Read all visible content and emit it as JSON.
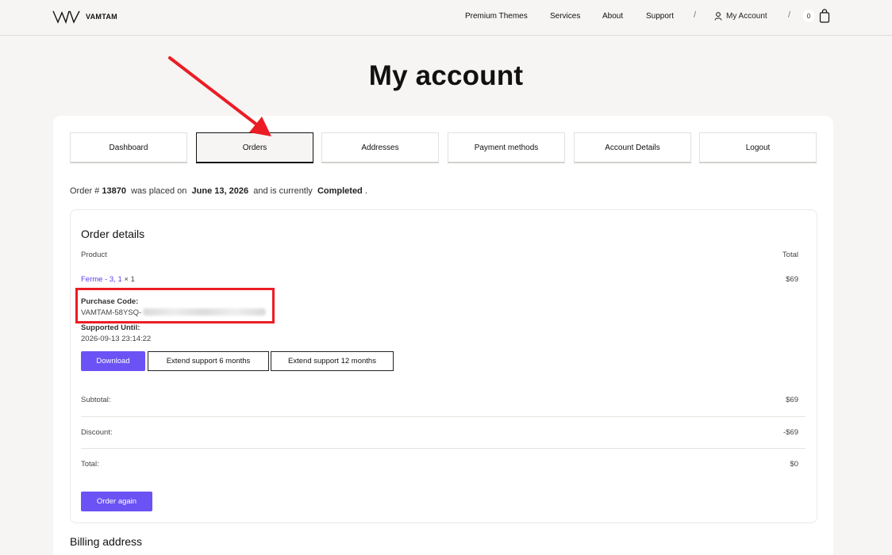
{
  "header": {
    "logo_text": "VAMTAM",
    "nav": [
      "Premium Themes",
      "Services",
      "About",
      "Support"
    ],
    "separator": "/",
    "account_label": "My Account",
    "cart_count": "0"
  },
  "page": {
    "title": "My account"
  },
  "tabs": [
    "Dashboard",
    "Orders",
    "Addresses",
    "Payment methods",
    "Account Details",
    "Logout"
  ],
  "active_tab": "Orders",
  "order_summary": {
    "prefix": "Order #",
    "number": "13870",
    "placed_text": "was placed on",
    "date": "June 13, 2026",
    "status_text": "and is currently",
    "status": "Completed",
    "end": "."
  },
  "order_details": {
    "title": "Order details",
    "col_product": "Product",
    "col_total": "Total",
    "product_link": "Ferme - 3, 1",
    "product_qty": "× 1",
    "product_total": "$69",
    "purchase_code_label": "Purchase Code:",
    "purchase_code_value": "VAMTAM-58YSQ-",
    "supported_until_label": "Supported Until:",
    "supported_until_value": "2026-09-13 23:14:22",
    "btn_download": "Download",
    "btn_extend_6": "Extend support 6 months",
    "btn_extend_12": "Extend support 12 months",
    "subtotal_label": "Subtotal:",
    "subtotal_value": "$69",
    "discount_label": "Discount:",
    "discount_value": "-$69",
    "total_label": "Total:",
    "total_value": "$0",
    "btn_order_again": "Order again"
  },
  "billing": {
    "title": "Billing address"
  },
  "colors": {
    "accent": "#6b52f5",
    "annotation": "#ec1c24"
  },
  "icons": [
    "vamtam-logo-icon",
    "user-icon",
    "shopping-bag-icon",
    "red-arrow-annotation"
  ]
}
